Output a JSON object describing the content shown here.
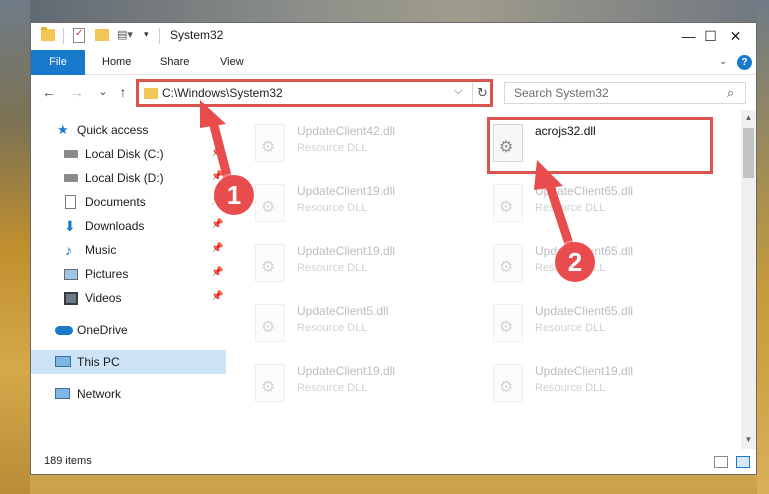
{
  "window": {
    "title": "System32"
  },
  "window_controls": {
    "minimize": "—",
    "maximize": "☐",
    "close": "✕"
  },
  "ribbon": {
    "tabs": [
      "File",
      "Home",
      "Share",
      "View"
    ],
    "help": "?"
  },
  "address_bar": {
    "path": "C:\\Windows\\System32",
    "dropdown": "⌵",
    "refresh": "↻"
  },
  "search": {
    "placeholder": "Search System32",
    "icon": "⌕"
  },
  "nav": {
    "back": "←",
    "forward": "→",
    "recent": "⌄",
    "up": "↑"
  },
  "sidebar": {
    "items": [
      {
        "label": "Quick access",
        "icon": "star-icon",
        "pinned": false
      },
      {
        "label": "Local Disk (C:)",
        "icon": "disk-icon",
        "pinned": true
      },
      {
        "label": "Local Disk (D:)",
        "icon": "disk-icon",
        "pinned": true
      },
      {
        "label": "Documents",
        "icon": "documents-icon",
        "pinned": true
      },
      {
        "label": "Downloads",
        "icon": "download-icon",
        "pinned": true
      },
      {
        "label": "Music",
        "icon": "music-icon",
        "pinned": true
      },
      {
        "label": "Pictures",
        "icon": "pictures-icon",
        "pinned": true
      },
      {
        "label": "Videos",
        "icon": "videos-icon",
        "pinned": true
      },
      {
        "label": "OneDrive",
        "icon": "cloud-icon",
        "pinned": false
      },
      {
        "label": "This PC",
        "icon": "computer-icon",
        "pinned": false,
        "selected": true
      },
      {
        "label": "Network",
        "icon": "network-icon",
        "pinned": false
      }
    ]
  },
  "files": {
    "left_column": [
      {
        "name": "UpdateClient42.dll",
        "type": "Resource DLL"
      },
      {
        "name": "UpdateClient19.dll",
        "type": "Resource DLL"
      },
      {
        "name": "UpdateClient19.dll",
        "type": "Resource DLL"
      },
      {
        "name": "UpdateClient5.dll",
        "type": "Resource DLL"
      },
      {
        "name": "UpdateClient19.dll",
        "type": "Resource DLL"
      }
    ],
    "right_column": [
      {
        "name": "acrojs32.dll",
        "type": ""
      },
      {
        "name": "UpdateClient65.dll",
        "type": "Resource DLL"
      },
      {
        "name": "UpdateClient65.dll",
        "type": "Resource DLL"
      },
      {
        "name": "UpdateClient65.dll",
        "type": "Resource DLL"
      },
      {
        "name": "UpdateClient19.dll",
        "type": "Resource DLL"
      }
    ]
  },
  "callouts": [
    "1",
    "2"
  ],
  "status": {
    "item_count": "189 items"
  },
  "colors": {
    "accent": "#1979ca",
    "callout": "#e84c4c",
    "selection": "#cde4f7"
  }
}
